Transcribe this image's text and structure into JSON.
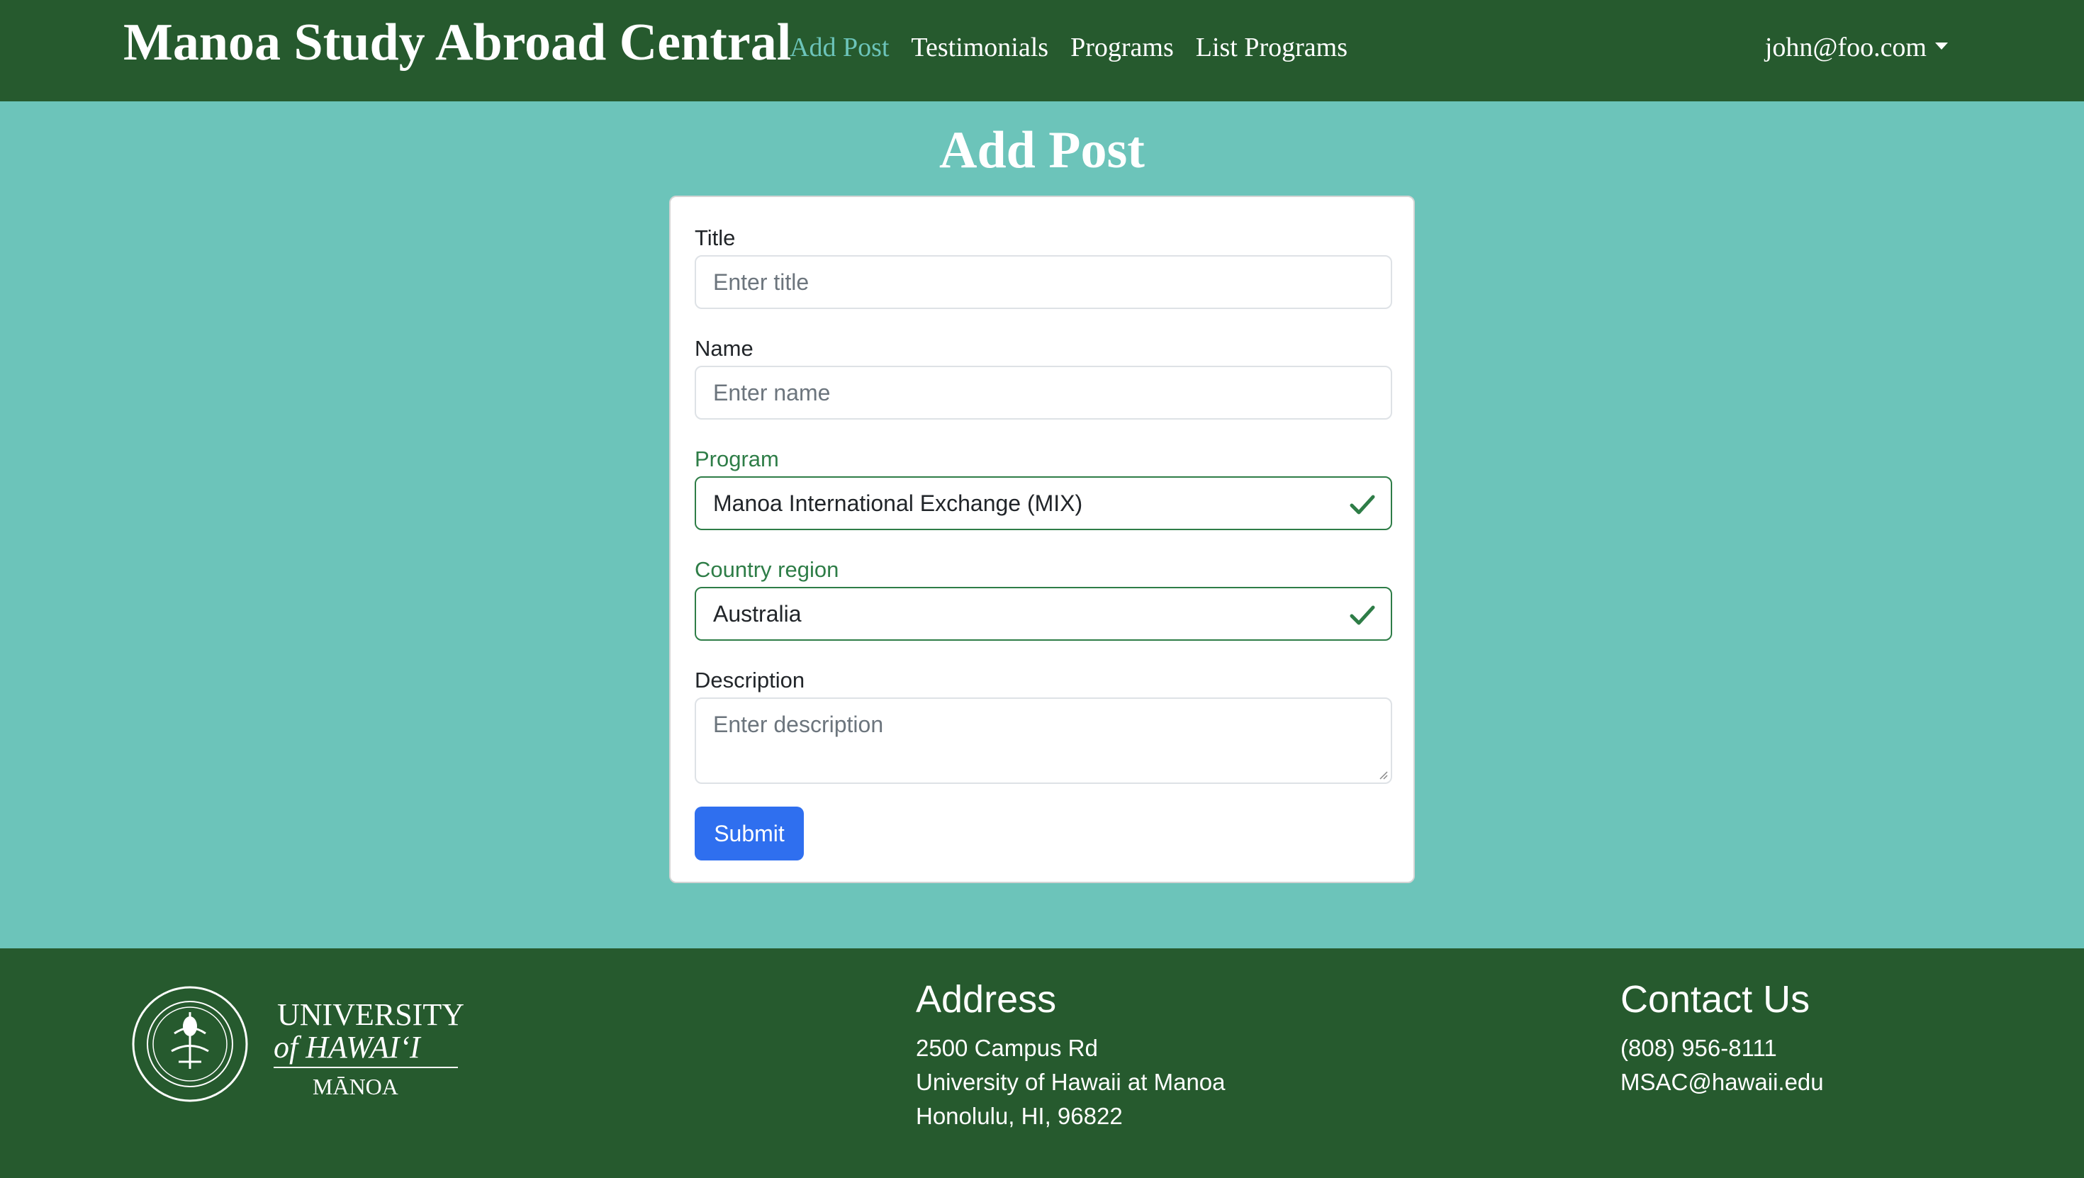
{
  "navbar": {
    "brand": "Manoa Study Abroad Central",
    "links": [
      "Add Post",
      "Testimonials",
      "Programs",
      "List Programs"
    ],
    "active_link": "Add Post",
    "user": "john@foo.com"
  },
  "page": {
    "title": "Add Post"
  },
  "form": {
    "title": {
      "label": "Title",
      "placeholder": "Enter title"
    },
    "name": {
      "label": "Name",
      "placeholder": "Enter name"
    },
    "program": {
      "label": "Program",
      "value": "Manoa International Exchange (MIX)",
      "status": "valid"
    },
    "country_region": {
      "label": "Country region",
      "value": "Australia",
      "status": "valid"
    },
    "description": {
      "label": "Description",
      "placeholder": "Enter description"
    },
    "submit_label": "Submit"
  },
  "footer": {
    "logo": {
      "line1": "UNIVERSITY",
      "line2": "of HAWAIʻI",
      "line3": "MĀNOA"
    },
    "address": {
      "heading": "Address",
      "lines": [
        "2500 Campus Rd",
        "University of Hawaii at Manoa",
        "Honolulu, HI, 96822"
      ]
    },
    "contact": {
      "heading": "Contact Us",
      "lines": [
        "(808) 956-8111",
        "MSAC@hawaii.edu"
      ]
    }
  },
  "colors": {
    "navbar": "#265a2e",
    "page_bg": "#6cc4ba",
    "accent_link": "#6cc4ba",
    "valid": "#2e7d47",
    "button": "#2f6fef"
  },
  "icons": {
    "valid_field": "check-icon",
    "user_menu": "caret-down-icon"
  }
}
